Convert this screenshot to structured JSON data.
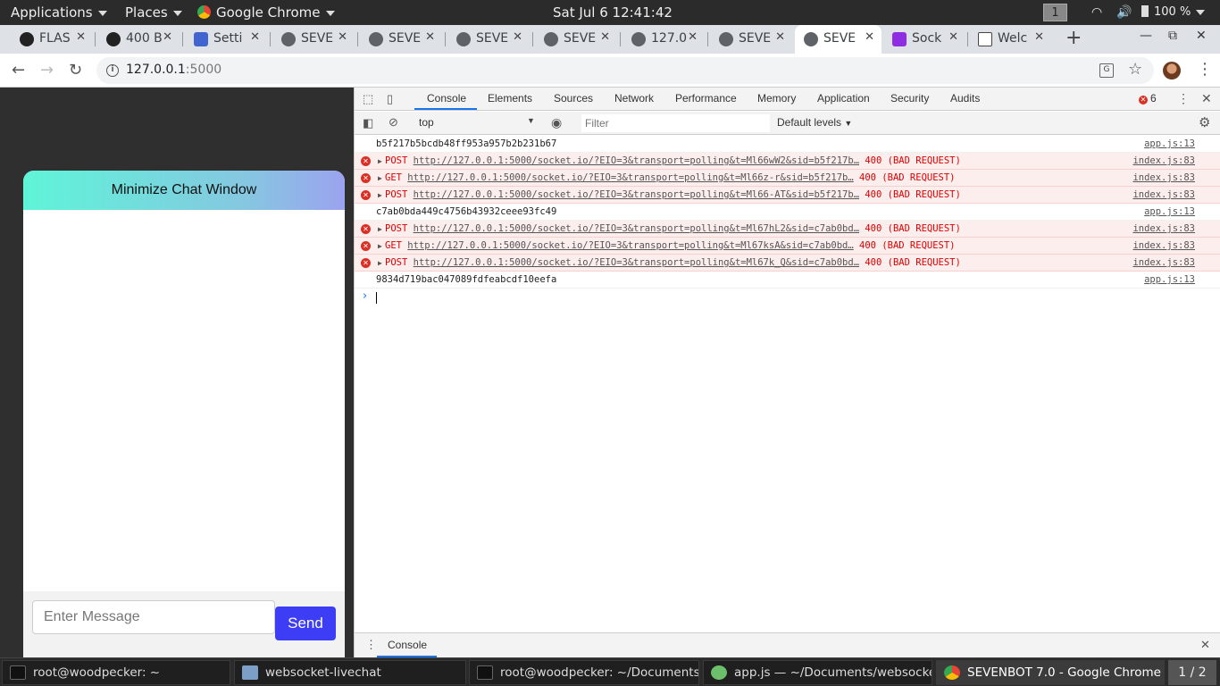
{
  "topbar": {
    "applications": "Applications",
    "places": "Places",
    "app_name": "Google Chrome",
    "clock": "Sat Jul 6  12:41:42",
    "workspace": "1",
    "battery": "100 %"
  },
  "tabs": [
    {
      "title": "FLAS",
      "icon": "github-icon"
    },
    {
      "title": "400 B",
      "icon": "github-icon"
    },
    {
      "title": "Setti",
      "icon": "settings-gear-icon"
    },
    {
      "title": "SEVE",
      "icon": "globe-icon"
    },
    {
      "title": "SEVE",
      "icon": "globe-icon"
    },
    {
      "title": "SEVE",
      "icon": "globe-icon"
    },
    {
      "title": "SEVE",
      "icon": "globe-icon"
    },
    {
      "title": "127.0",
      "icon": "globe-icon"
    },
    {
      "title": "SEVE",
      "icon": "globe-icon"
    },
    {
      "title": "SEVE",
      "icon": "globe-icon",
      "active": true
    },
    {
      "title": "Sock",
      "icon": "purple-e-icon"
    },
    {
      "title": "Welc",
      "icon": "book-icon"
    }
  ],
  "address": {
    "host": "127.0.0.1",
    "port": ":5000"
  },
  "chat": {
    "header": "Minimize Chat Window",
    "input_placeholder": "Enter Message",
    "send_label": "Send"
  },
  "devtools": {
    "tabs": [
      "Console",
      "Elements",
      "Sources",
      "Network",
      "Performance",
      "Memory",
      "Application",
      "Security",
      "Audits"
    ],
    "error_count": "6",
    "context": "top",
    "filter_placeholder": "Filter",
    "levels": "Default levels",
    "drawer_tab": "Console",
    "log": [
      {
        "type": "info",
        "text": "b5f217b5bcdb48ff953a957b2b231b67",
        "src": "app.js:13"
      },
      {
        "type": "error",
        "method": "POST",
        "url": "http://127.0.0.1:5000/socket.io/?EIO=3&transport=polling&t=Ml66wW2&sid=b5f217b…",
        "status": "400 (BAD REQUEST)",
        "src": "index.js:83"
      },
      {
        "type": "error",
        "method": "GET",
        "url": "http://127.0.0.1:5000/socket.io/?EIO=3&transport=polling&t=Ml66z-r&sid=b5f217b…",
        "status": "400 (BAD REQUEST)",
        "src": "index.js:83"
      },
      {
        "type": "error",
        "method": "POST",
        "url": "http://127.0.0.1:5000/socket.io/?EIO=3&transport=polling&t=Ml66-AT&sid=b5f217b…",
        "status": "400 (BAD REQUEST)",
        "src": "index.js:83"
      },
      {
        "type": "info",
        "text": "c7ab0bda449c4756b43932ceee93fc49",
        "src": "app.js:13"
      },
      {
        "type": "error",
        "method": "POST",
        "url": "http://127.0.0.1:5000/socket.io/?EIO=3&transport=polling&t=Ml67hL2&sid=c7ab0bd…",
        "status": "400 (BAD REQUEST)",
        "src": "index.js:83"
      },
      {
        "type": "error",
        "method": "GET",
        "url": "http://127.0.0.1:5000/socket.io/?EIO=3&transport=polling&t=Ml67ksA&sid=c7ab0bd…",
        "status": "400 (BAD REQUEST)",
        "src": "index.js:83"
      },
      {
        "type": "error",
        "method": "POST",
        "url": "http://127.0.0.1:5000/socket.io/?EIO=3&transport=polling&t=Ml67k_Q&sid=c7ab0bd…",
        "status": "400 (BAD REQUEST)",
        "src": "index.js:83"
      },
      {
        "type": "info",
        "text": "9834d719bac047089fdfeabcdf10eefa",
        "src": "app.js:13"
      }
    ]
  },
  "taskbar": {
    "items": [
      {
        "label": "root@woodpecker: ~",
        "icon": "terminal-icon"
      },
      {
        "label": "websocket-livechat",
        "icon": "folder-icon"
      },
      {
        "label": "root@woodpecker: ~/Documents…",
        "icon": "terminal-icon"
      },
      {
        "label": "app.js — ~/Documents/websocke…",
        "icon": "atom-icon"
      },
      {
        "label": "SEVENBOT 7.0 - Google Chrome",
        "icon": "chrome-icon",
        "active": true
      }
    ],
    "pager": "1 / 2"
  },
  "colors": {
    "chat_header_gradient": [
      "#5ef5d8",
      "#86c6e1",
      "#9ba3ef"
    ],
    "send_button": "#3d3df5",
    "error_text": "#dd0000",
    "error_bg": "#fdeeee",
    "devtools_accent": "#1a73e8"
  }
}
